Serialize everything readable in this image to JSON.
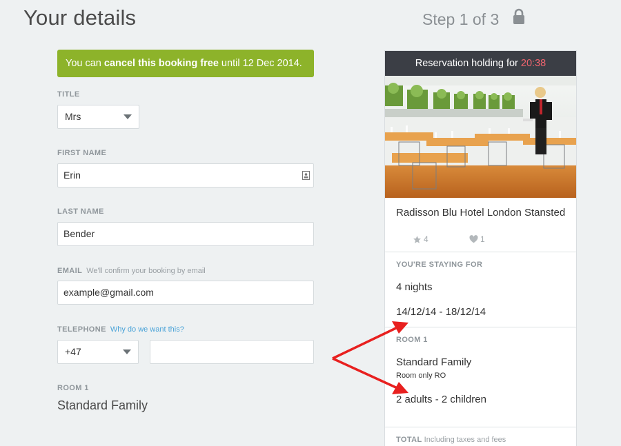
{
  "header": {
    "title": "Your details",
    "step": "Step 1 of 3"
  },
  "banner": {
    "prefix": "You can ",
    "bold": "cancel this booking free",
    "suffix": " until 12 Dec 2014."
  },
  "form": {
    "title_label": "TITLE",
    "title_value": "Mrs",
    "first_name_label": "FIRST NAME",
    "first_name_value": "Erin",
    "last_name_label": "LAST NAME",
    "last_name_value": "Bender",
    "email_label": "EMAIL",
    "email_hint": "We'll confirm your booking by email",
    "email_value": "example@gmail.com",
    "telephone_label": "TELEPHONE",
    "telephone_link": "Why do we want this?",
    "telephone_code": "+47",
    "telephone_value": "",
    "room_label": "ROOM 1",
    "room_name": "Standard Family"
  },
  "summary": {
    "holding_prefix": "Reservation holding for ",
    "holding_timer": "20:38",
    "hotel_name": "Radisson Blu Hotel London Stansted",
    "rating": "4",
    "likes": "1",
    "staying_label": "YOU'RE STAYING FOR",
    "nights": "4 nights",
    "dates": "14/12/14 - 18/12/14",
    "room_label": "ROOM 1",
    "room_name": "Standard Family",
    "room_board": "Room only RO",
    "occupancy": "2 adults - 2 children",
    "total_label": "TOTAL",
    "total_hint": "Including taxes and fees"
  },
  "colors": {
    "banner_green": "#8db32a",
    "timer_red": "#f0646e",
    "link_blue": "#4aa3d8",
    "arrow_red": "#e8201f"
  },
  "icons": {
    "lock": "lock-icon",
    "contact": "contact-card-icon",
    "star": "star-icon",
    "heart": "heart-icon"
  }
}
